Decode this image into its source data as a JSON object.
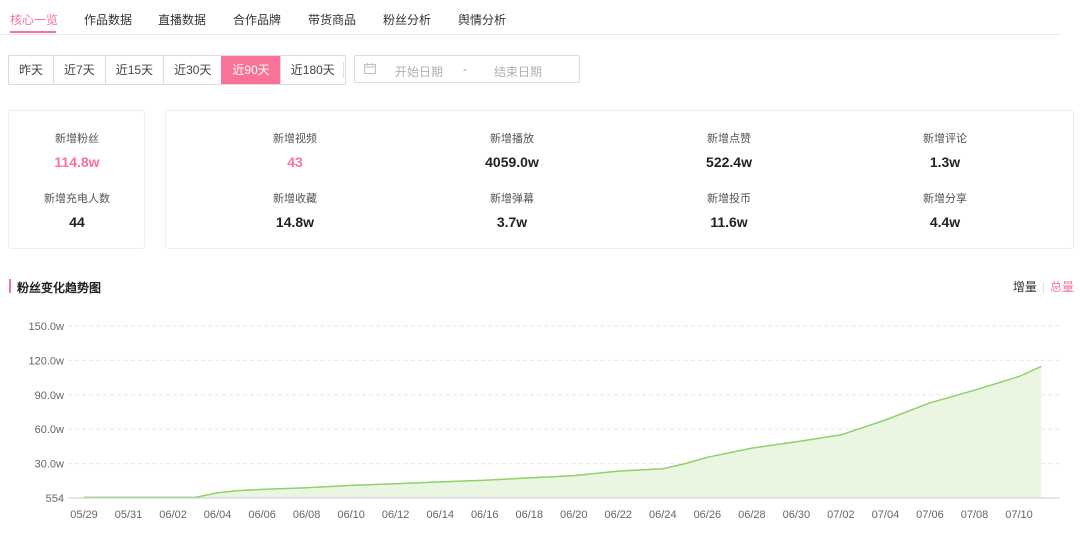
{
  "tabs": [
    {
      "label": "核心一览",
      "active": true
    },
    {
      "label": "作品数据",
      "active": false
    },
    {
      "label": "直播数据",
      "active": false
    },
    {
      "label": "合作品牌",
      "active": false
    },
    {
      "label": "带货商品",
      "active": false
    },
    {
      "label": "粉丝分析",
      "active": false
    },
    {
      "label": "舆情分析",
      "active": false
    }
  ],
  "date_ranges": [
    {
      "label": "昨天",
      "active": false
    },
    {
      "label": "近7天",
      "active": false
    },
    {
      "label": "近15天",
      "active": false
    },
    {
      "label": "近30天",
      "active": false
    },
    {
      "label": "近90天",
      "active": true
    },
    {
      "label": "近180天",
      "active": false
    }
  ],
  "date_picker": {
    "start_placeholder": "开始日期",
    "separator": "-",
    "end_placeholder": "结束日期"
  },
  "stats_left": [
    {
      "label": "新增粉丝",
      "value": "114.8w",
      "highlight": true
    },
    {
      "label": "新增充电人数",
      "value": "44",
      "highlight": false
    }
  ],
  "stats_right": [
    {
      "label": "新增视频",
      "value": "43",
      "highlight": true
    },
    {
      "label": "新增播放",
      "value": "4059.0w",
      "highlight": false
    },
    {
      "label": "新增点赞",
      "value": "522.4w",
      "highlight": false
    },
    {
      "label": "新增评论",
      "value": "1.3w",
      "highlight": false
    },
    {
      "label": "新增收藏",
      "value": "14.8w",
      "highlight": false
    },
    {
      "label": "新增弹幕",
      "value": "3.7w",
      "highlight": false
    },
    {
      "label": "新增投币",
      "value": "11.6w",
      "highlight": false
    },
    {
      "label": "新增分享",
      "value": "4.4w",
      "highlight": false
    }
  ],
  "section": {
    "title": "粉丝变化趋势图",
    "toggle_increment": "增量",
    "toggle_separator": "|",
    "toggle_total": "总量"
  },
  "colors": {
    "accent": "#fb7299",
    "line": "#8fd16a",
    "area": "#eaf6e2"
  },
  "chart_data": {
    "type": "area",
    "yticks": [
      "554",
      "30.0w",
      "60.0w",
      "90.0w",
      "120.0w",
      "150.0w"
    ],
    "ytick_values": [
      0,
      30,
      60,
      90,
      120,
      150
    ],
    "xticks": [
      "05/29",
      "05/31",
      "06/02",
      "06/04",
      "06/06",
      "06/08",
      "06/10",
      "06/12",
      "06/14",
      "06/16",
      "06/18",
      "06/20",
      "06/22",
      "06/24",
      "06/26",
      "06/28",
      "06/30",
      "07/02",
      "07/04",
      "07/06",
      "07/08",
      "07/10"
    ],
    "ylim": [
      0,
      150
    ],
    "x": [
      "05/29",
      "05/31",
      "06/02",
      "06/03",
      "06/04",
      "06/05",
      "06/06",
      "06/08",
      "06/10",
      "06/12",
      "06/14",
      "06/16",
      "06/18",
      "06/20",
      "06/22",
      "06/24",
      "06/25",
      "06/26",
      "06/28",
      "06/30",
      "07/02",
      "07/04",
      "07/06",
      "07/08",
      "07/10",
      "07/11"
    ],
    "values": [
      0.5,
      0.5,
      0.5,
      0.5,
      4.5,
      6.5,
      7.5,
      9.0,
      11.0,
      12.5,
      14.0,
      15.5,
      17.5,
      19.5,
      23.5,
      25.5,
      30.0,
      35.5,
      43.5,
      49.0,
      55.0,
      68.0,
      83.0,
      94.0,
      106.0,
      114.8
    ]
  }
}
